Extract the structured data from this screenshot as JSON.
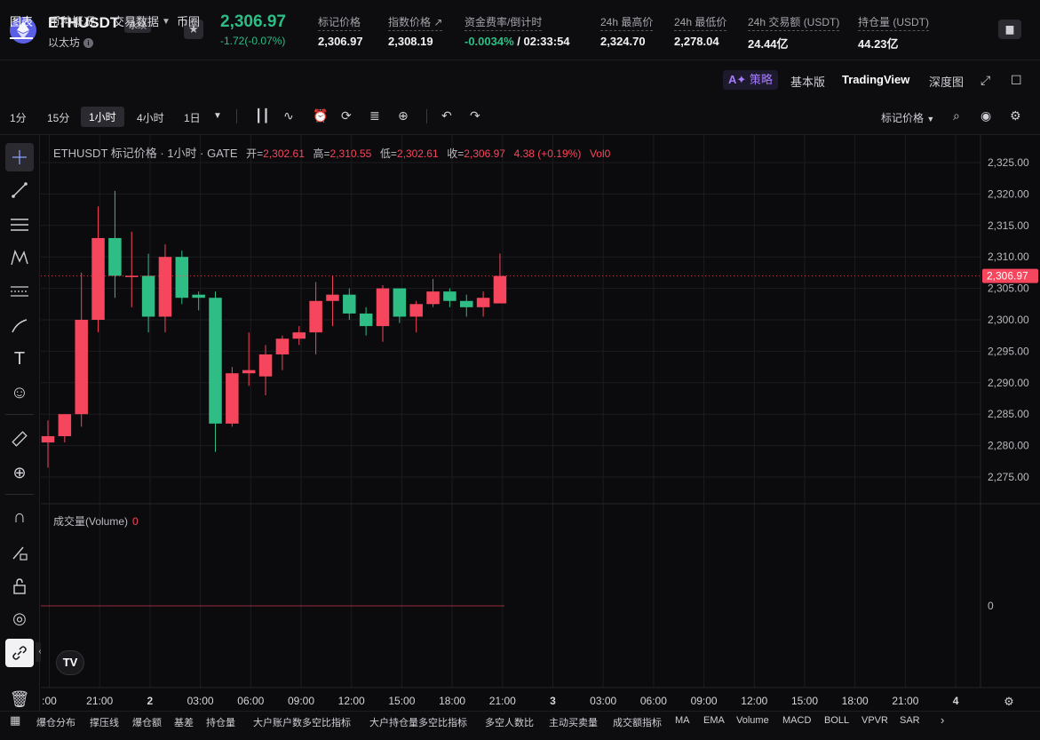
{
  "header": {
    "symbol": "ETHUSDT",
    "badge": "永续",
    "coin_name": "以太坊",
    "price": "2,306.97",
    "change": "-1.72(-0.07%)",
    "stats": [
      {
        "label": "标记价格",
        "value": "2,306.97"
      },
      {
        "label": "指数价格 ↗",
        "value": "2,308.19"
      },
      {
        "label": "资金费率/倒计时",
        "value_green": "-0.0034%",
        "value_rest": " / 02:33:54"
      },
      {
        "label": "24h 最高价",
        "value": "2,324.70"
      },
      {
        "label": "24h 最低价",
        "value": "2,278.04"
      },
      {
        "label": "24h 交易额 (USDT)",
        "value": "24.44亿"
      },
      {
        "label": "持仓量 (USDT)",
        "value": "44.23亿"
      }
    ]
  },
  "tabs": [
    "图表",
    "币种概况",
    "交易数据",
    "币圈"
  ],
  "ai_label": "策略",
  "view_tabs": [
    "基本版",
    "TradingView",
    "深度图"
  ],
  "intervals": [
    "1分",
    "15分",
    "1小时",
    "4小时",
    "1日"
  ],
  "price_type": "标记价格",
  "legend": {
    "title": "ETHUSDT 标记价格 · 1小时 · GATE",
    "open_label": "开=",
    "open": "2,302.61",
    "high_label": "高=",
    "high": "2,310.55",
    "low_label": "低=",
    "low": "2,302.61",
    "close_label": "收=",
    "close": "2,306.97",
    "change": "4.38 (+0.19%)",
    "vol": "Vol0"
  },
  "volume_legend": {
    "label": "成交量(Volume)",
    "value": "0"
  },
  "indicators": [
    "爆仓分布",
    "撑压线",
    "爆仓额",
    "基差",
    "持仓量",
    "大户账户数多空比指标",
    "大户持仓量多空比指标",
    "多空人数比",
    "主动买卖量",
    "成交额指标",
    "MA",
    "EMA",
    "Volume",
    "MACD",
    "BOLL",
    "VPVR",
    "SAR"
  ],
  "tv_logo": "TV",
  "chart_data": {
    "type": "candlestick",
    "ylim": [
      2272,
      2327
    ],
    "y_ticks": [
      2275,
      2280,
      2285,
      2290,
      2295,
      2300,
      2305,
      2310,
      2315,
      2320,
      2325
    ],
    "y_tick_labels": [
      "2,275.00",
      "2,280.00",
      "2,285.00",
      "2,290.00",
      "2,295.00",
      "2,300.00",
      "2,305.00",
      "2,310.00",
      "2,315.00",
      "2,320.00",
      "2,325.00"
    ],
    "last_price": 2306.97,
    "last_price_label": "2,306.97",
    "x_labels": [
      ":00",
      "21:00",
      "2",
      "03:00",
      "06:00",
      "09:00",
      "12:00",
      "15:00",
      "18:00",
      "21:00",
      "3",
      "03:00",
      "06:00",
      "09:00",
      "12:00",
      "15:00",
      "18:00",
      "21:00",
      "4"
    ],
    "volume_zero_label": "0",
    "candles": [
      {
        "o": 2280.5,
        "h": 2284.0,
        "l": 2276.5,
        "c": 2281.5
      },
      {
        "o": 2281.5,
        "h": 2285.0,
        "l": 2280.5,
        "c": 2285.0
      },
      {
        "o": 2285.0,
        "h": 2307.5,
        "l": 2283.0,
        "c": 2300.0
      },
      {
        "o": 2300.0,
        "h": 2318.0,
        "l": 2298.0,
        "c": 2313.0
      },
      {
        "o": 2313.0,
        "h": 2320.5,
        "l": 2303.5,
        "c": 2307.0
      },
      {
        "o": 2307.0,
        "h": 2314.0,
        "l": 2302.0,
        "c": 2307.0
      },
      {
        "o": 2307.0,
        "h": 2310.5,
        "l": 2298.0,
        "c": 2300.5
      },
      {
        "o": 2300.5,
        "h": 2312.0,
        "l": 2298.0,
        "c": 2310.0
      },
      {
        "o": 2310.0,
        "h": 2311.0,
        "l": 2302.5,
        "c": 2303.5
      },
      {
        "o": 2304.0,
        "h": 2304.5,
        "l": 2301.5,
        "c": 2303.5
      },
      {
        "o": 2303.5,
        "h": 2304.5,
        "l": 2279.0,
        "c": 2283.5
      },
      {
        "o": 2283.5,
        "h": 2292.5,
        "l": 2283.0,
        "c": 2291.5
      },
      {
        "o": 2291.5,
        "h": 2298.0,
        "l": 2289.5,
        "c": 2292.0
      },
      {
        "o": 2291.0,
        "h": 2296.0,
        "l": 2288.0,
        "c": 2294.5
      },
      {
        "o": 2294.5,
        "h": 2297.5,
        "l": 2292.0,
        "c": 2297.0
      },
      {
        "o": 2297.0,
        "h": 2299.0,
        "l": 2296.0,
        "c": 2298.0
      },
      {
        "o": 2298.0,
        "h": 2306.0,
        "l": 2294.5,
        "c": 2303.0
      },
      {
        "o": 2303.0,
        "h": 2307.0,
        "l": 2299.0,
        "c": 2304.0
      },
      {
        "o": 2304.0,
        "h": 2305.0,
        "l": 2300.0,
        "c": 2301.0
      },
      {
        "o": 2301.0,
        "h": 2302.0,
        "l": 2297.5,
        "c": 2299.0
      },
      {
        "o": 2299.0,
        "h": 2305.5,
        "l": 2296.5,
        "c": 2305.0
      },
      {
        "o": 2305.0,
        "h": 2305.0,
        "l": 2299.5,
        "c": 2300.5
      },
      {
        "o": 2300.5,
        "h": 2303.0,
        "l": 2298.0,
        "c": 2302.5
      },
      {
        "o": 2302.5,
        "h": 2306.5,
        "l": 2302.0,
        "c": 2304.5
      },
      {
        "o": 2304.5,
        "h": 2305.0,
        "l": 2302.0,
        "c": 2303.0
      },
      {
        "o": 2303.0,
        "h": 2304.0,
        "l": 2300.5,
        "c": 2302.0
      },
      {
        "o": 2302.0,
        "h": 2304.5,
        "l": 2300.5,
        "c": 2303.5
      },
      {
        "o": 2302.61,
        "h": 2310.55,
        "l": 2302.61,
        "c": 2306.97
      }
    ],
    "colors": {
      "up": "#f6465d",
      "down": "#2ebd85",
      "grid": "#1c1c20"
    }
  }
}
